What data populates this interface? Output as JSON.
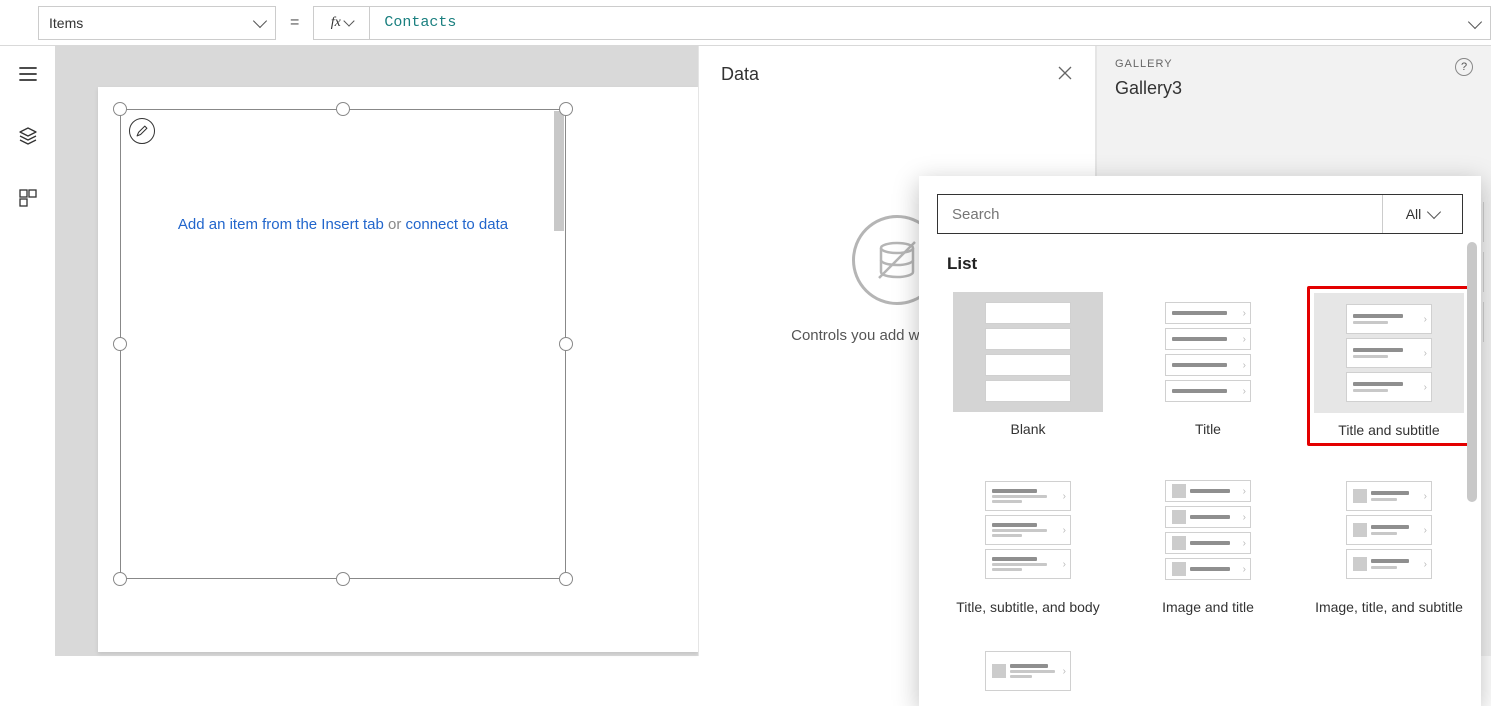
{
  "formula": {
    "property": "Items",
    "equals": "=",
    "fx": "fx",
    "value": "Contacts"
  },
  "canvas": {
    "placeholder_pre": "Add an item from the Insert tab",
    "placeholder_or": " or ",
    "placeholder_link": "connect to data"
  },
  "dataPanel": {
    "title": "Data",
    "empty_text": "Controls you add will show here"
  },
  "rightPanel": {
    "category": "GALLERY",
    "name": "Gallery3"
  },
  "layoutPopup": {
    "search_placeholder": "Search",
    "filter_label": "All",
    "section_title": "List",
    "items": [
      {
        "label": "Blank"
      },
      {
        "label": "Title"
      },
      {
        "label": "Title and subtitle"
      },
      {
        "label": "Title, subtitle, and body"
      },
      {
        "label": "Image and title"
      },
      {
        "label": "Image, title, and subtitle"
      }
    ]
  }
}
